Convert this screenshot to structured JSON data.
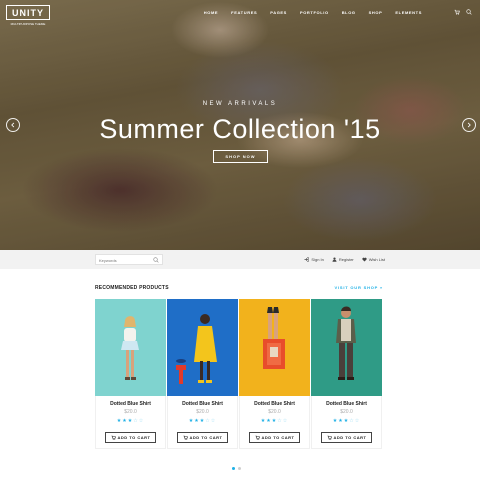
{
  "brand": {
    "logo": "UNITY",
    "logo_sub": "MULTIPURPOSE THEME"
  },
  "nav": {
    "items": [
      "HOME",
      "FEATURES",
      "PAGES",
      "PORTFOLIO",
      "BLOG",
      "SHOP",
      "ELEMENTS"
    ]
  },
  "hero": {
    "kicker": "NEW ARRIVALS",
    "title": "Summer Collection '15",
    "cta": "SHOP NOW"
  },
  "search": {
    "placeholder": "Keywords"
  },
  "account": {
    "sign_in": "Sign In",
    "register": "Register",
    "wish_list": "Wish List"
  },
  "section": {
    "title": "RECOMMENDED PRODUCTS",
    "visit_link": "VISIT OUR SHOP »"
  },
  "products": [
    {
      "name": "Dotted Blue Shirt",
      "price": "$20.0",
      "rating": 3,
      "cart_label": "ADD TO CART",
      "bg": "#7fd3cf"
    },
    {
      "name": "Dotted Blue Shirt",
      "price": "$20.0",
      "rating": 3,
      "cart_label": "ADD TO CART",
      "bg": "#1f6ec7"
    },
    {
      "name": "Dotted Blue Shirt",
      "price": "$20.0",
      "rating": 3,
      "cart_label": "ADD TO CART",
      "bg": "#f2b21c"
    },
    {
      "name": "Dotted Blue Shirt",
      "price": "$20.0",
      "rating": 3,
      "cart_label": "ADD TO CART",
      "bg": "#2f9b86"
    }
  ],
  "colors": {
    "accent": "#1eb0e6"
  },
  "carousel": {
    "pages": 2,
    "active": 1
  }
}
